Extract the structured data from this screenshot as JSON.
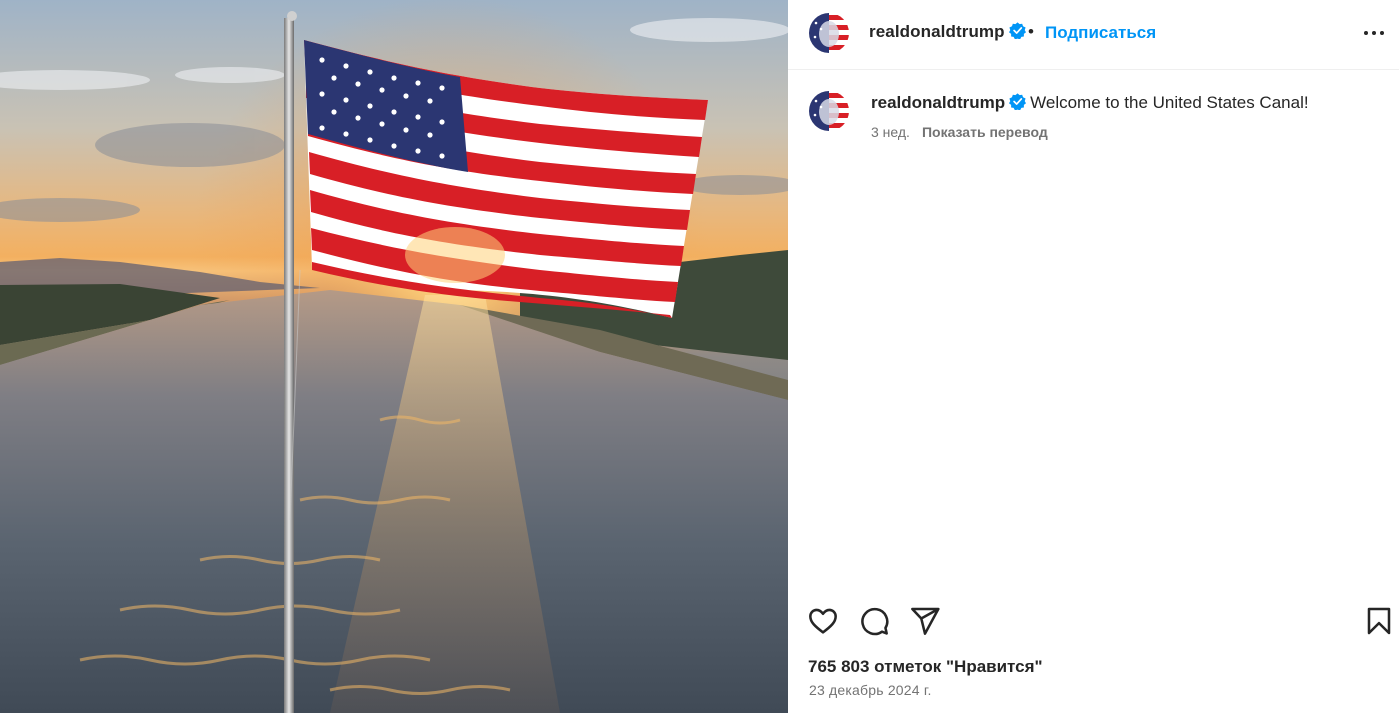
{
  "post": {
    "username": "realdonaldtrump",
    "follow_label": "Подписаться",
    "separator": "•",
    "caption": "Welcome to the United States Canal!",
    "time_ago": "3 нед.",
    "translate_label": "Показать перевод",
    "likes": "765 803 отметок \"Нравится\"",
    "date": "23 декабрь 2024 г."
  },
  "icons": {
    "more": "more-options-icon",
    "like": "heart-icon",
    "comment": "comment-icon",
    "share": "send-icon",
    "save": "bookmark-icon",
    "verified": "verified-badge-icon"
  },
  "colors": {
    "link": "#0095f6",
    "text": "#262626",
    "secondary": "#737373",
    "verified": "#0095f6"
  }
}
